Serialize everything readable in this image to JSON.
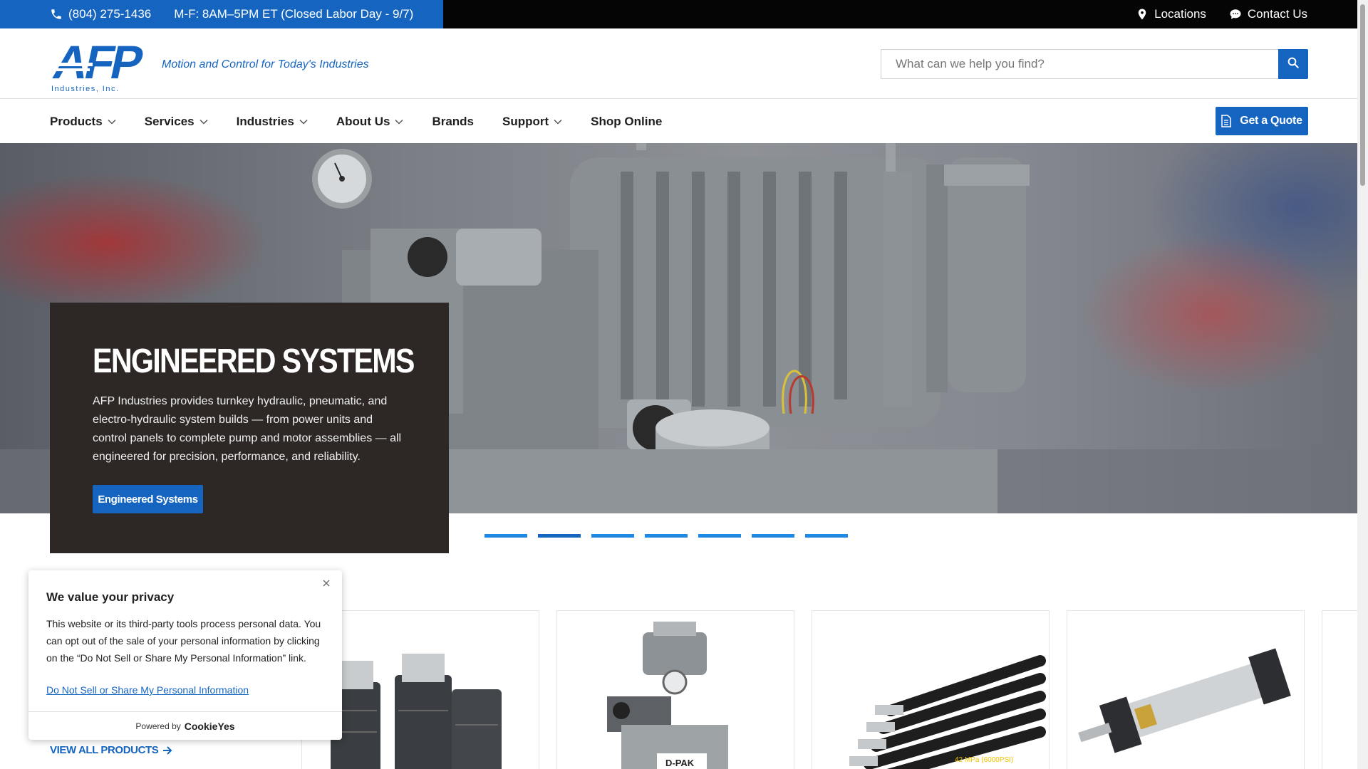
{
  "topbar": {
    "phone": "(804) 275-1436",
    "hours": "M-F: 8AM–5PM ET (Closed Labor Day - 9/7)",
    "locations_label": "Locations",
    "contact_label": "Contact Us"
  },
  "header": {
    "logo_text": "AFP",
    "logo_subtext": "Industries, Inc.",
    "tagline": "Motion and Control for Today's Industries",
    "search_placeholder": "What can we help you find?"
  },
  "nav": {
    "items": [
      {
        "label": "Products",
        "has_dropdown": true
      },
      {
        "label": "Services",
        "has_dropdown": true
      },
      {
        "label": "Industries",
        "has_dropdown": true
      },
      {
        "label": "About Us",
        "has_dropdown": true
      },
      {
        "label": "Brands",
        "has_dropdown": false
      },
      {
        "label": "Support",
        "has_dropdown": true
      },
      {
        "label": "Shop Online",
        "has_dropdown": false
      }
    ],
    "quote_label": "Get a Quote"
  },
  "hero": {
    "title": "ENGINEERED SYSTEMS",
    "text": "AFP Industries provides turnkey hydraulic, pneumatic, and electro-hydraulic system builds — from power units and control panels to complete pump and motor assemblies — all engineered for precision, performance, and reliability.",
    "button_label": "Engineered Systems",
    "slides": 7,
    "active_slide": 2
  },
  "products": {
    "view_all_label": "VIEW ALL PRODUCTS",
    "power_unit_label": "D-PAK",
    "hose_spec": "42 MPa (6000PSI)"
  },
  "cookie": {
    "title": "We value your privacy",
    "body": "This website or its third-party tools process personal data. You can opt out of the sale of your personal information by clicking on the “Do Not Sell or Share My Personal Information” link.",
    "link": "Do Not Sell or Share My Personal Information",
    "powered_by": "Powered by",
    "brand": "CookieYes"
  },
  "colors": {
    "brand_blue": "#1565c0",
    "topbar_dark": "#050505",
    "hero_card": "#2d2826"
  }
}
